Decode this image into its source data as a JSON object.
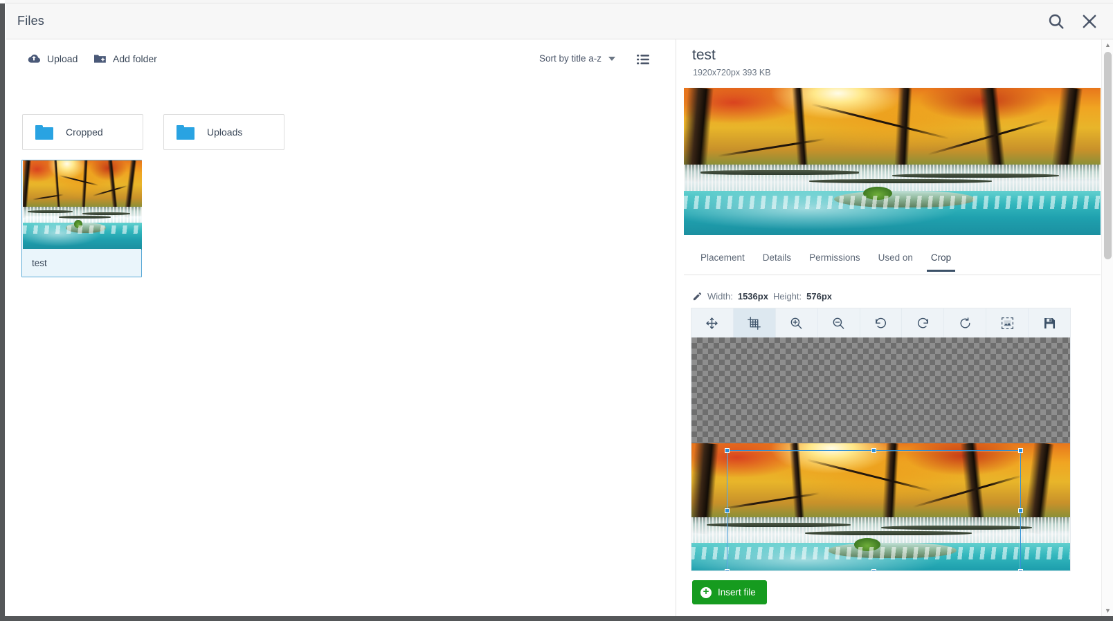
{
  "window": {
    "title": "Files",
    "search_icon": "search-icon",
    "close_icon": "close-icon"
  },
  "browser": {
    "toolbar": {
      "upload_label": "Upload",
      "upload_icon": "cloud-upload-icon",
      "add_folder_label": "Add folder",
      "add_folder_icon": "folder-add-icon",
      "sort_label": "Sort by title a-z",
      "sort_caret_icon": "chevron-down-icon",
      "view_toggle_icon": "list-view-icon"
    },
    "folders": [
      {
        "label": "Cropped",
        "icon": "folder-icon"
      },
      {
        "label": "Uploads",
        "icon": "folder-icon"
      }
    ],
    "files": [
      {
        "name": "test",
        "selected": true
      }
    ]
  },
  "details": {
    "title": "test",
    "meta": "1920x720px 393 KB",
    "tabs": [
      {
        "label": "Placement",
        "active": false
      },
      {
        "label": "Details",
        "active": false
      },
      {
        "label": "Permissions",
        "active": false
      },
      {
        "label": "Used on",
        "active": false
      },
      {
        "label": "Crop",
        "active": true
      }
    ],
    "crop": {
      "edit_icon": "pencil-icon",
      "width_label": "Width:",
      "width_value": "1536px",
      "height_label": "Height:",
      "height_value": "576px",
      "tools": [
        {
          "name": "move-tool",
          "icon": "move-arrows-icon",
          "active": false
        },
        {
          "name": "crop-tool",
          "icon": "crop-grid-icon",
          "active": true
        },
        {
          "name": "zoom-in-tool",
          "icon": "zoom-in-icon",
          "active": false
        },
        {
          "name": "zoom-out-tool",
          "icon": "zoom-out-icon",
          "active": false
        },
        {
          "name": "rotate-left-tool",
          "icon": "rotate-left-icon",
          "active": false
        },
        {
          "name": "rotate-right-tool",
          "icon": "rotate-right-icon",
          "active": false
        },
        {
          "name": "reset-tool",
          "icon": "refresh-circle-icon",
          "active": false
        },
        {
          "name": "select-all-tool",
          "icon": "image-select-icon",
          "active": false
        },
        {
          "name": "save-tool",
          "icon": "save-disk-icon",
          "active": false
        }
      ]
    },
    "footer": {
      "insert_label": "Insert file",
      "insert_icon": "plus-circle-icon",
      "insert_color": "#169b1f"
    },
    "scrollbar": {
      "up_icon": "caret-up-icon",
      "down_icon": "caret-down-icon"
    }
  },
  "colors": {
    "accent_blue": "#29a3e2",
    "crop_selection": "#2d8fd5",
    "text_dark": "#3b4859",
    "text_muted": "#6b7684",
    "tab_underline": "#3c5168",
    "insert_green": "#169b1f"
  }
}
